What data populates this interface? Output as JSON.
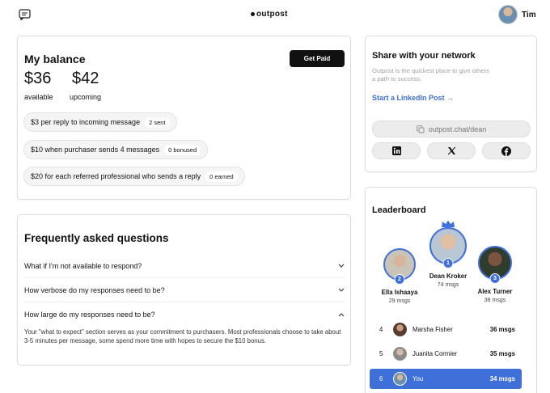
{
  "header": {
    "logo_text": "outpost",
    "user_name": "Tim"
  },
  "balance": {
    "title": "My balance",
    "get_paid_label": "Get Paid",
    "available_amount": "$36",
    "available_label": "available",
    "upcoming_amount": "$42",
    "upcoming_label": "upcoming",
    "earnings": [
      {
        "text": "$3 per reply to incoming message",
        "badge": "2 sent"
      },
      {
        "text": "$10 when purchaser sends 4 messages",
        "badge": "0 bonused"
      },
      {
        "text": "$20 for each referred professional who sends a reply",
        "badge": "0 earned"
      }
    ]
  },
  "faq": {
    "title": "Frequently asked questions",
    "items": [
      {
        "question": "What if I'm not available to respond?",
        "expanded": false
      },
      {
        "question": "How verbose do my responses need to be?",
        "expanded": false
      },
      {
        "question": "How large do my responses need to be?",
        "expanded": true
      }
    ],
    "answer": "Your \"what to expect\" section serves as your commitment to purchasers. Most professionals choose to take about 3-5 minutes per message, some spend more time with hopes to secure the $10 bonus."
  },
  "share": {
    "title": "Share with your network",
    "description": "Outpost is the quickest place to give others a path to success.",
    "linkedin_link": "Start a LinkedIn Post →",
    "share_url": "outpost.chat/dean",
    "socials": [
      "linkedin-icon",
      "x-icon",
      "facebook-icon"
    ]
  },
  "leaderboard": {
    "title": "Leaderboard",
    "podium": [
      {
        "rank": "1",
        "name": "Dean Kroker",
        "msgs": "74 msgs"
      },
      {
        "rank": "2",
        "name": "Ella Ishaaya",
        "msgs": "29 msgs"
      },
      {
        "rank": "3",
        "name": "Alex Turner",
        "msgs": "38 msgs"
      }
    ],
    "rows": [
      {
        "rank": "4",
        "name": "Marsha Fisher",
        "msgs": "36 msgs"
      },
      {
        "rank": "5",
        "name": "Juanita Cormier",
        "msgs": "35 msgs"
      },
      {
        "rank": "6",
        "name": "You",
        "msgs": "34 msgs"
      }
    ]
  },
  "colors": {
    "accent": "#3f6fd8",
    "button_dark": "#111111"
  }
}
